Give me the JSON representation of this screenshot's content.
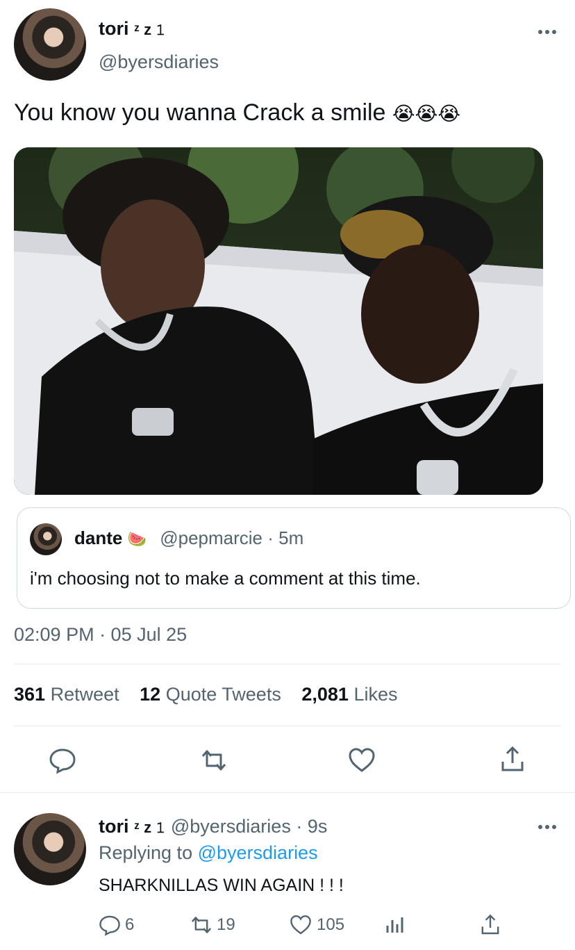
{
  "tweet": {
    "author_name": "tori",
    "author_name_decor": "ᶻ z 𝟷",
    "author_handle": "@byersdiaries",
    "text": "You know you wanna Crack a smile",
    "emoji": "😭😭😭",
    "timestamp": "02:09 PM · 05 Jul 25",
    "stats": {
      "retweets_count": "361",
      "retweets_label": "Retweet",
      "quotes_count": "12",
      "quotes_label": "Quote Tweets",
      "likes_count": "2,081",
      "likes_label": "Likes"
    }
  },
  "quoted": {
    "name": "dante",
    "emoji": "🍉",
    "meta": "@pepmarcie · 5m",
    "text": "i'm choosing not to make a comment at this time."
  },
  "reply": {
    "author_name": "tori",
    "author_name_decor": "ᶻ z 𝟷",
    "handle_time": "@byersdiaries · 9s",
    "replying_prefix": "Replying to",
    "replying_to": "@byersdiaries",
    "text": "SHARKNILLAS WIN AGAIN ! ! !",
    "counts": {
      "replies": "6",
      "retweets": "19",
      "likes": "105"
    }
  },
  "icons": {
    "more": "more-horizontal-icon",
    "reply": "speech-bubble-icon",
    "retweet": "retweet-arrows-icon",
    "like": "heart-icon",
    "share": "share-upload-icon",
    "analytics": "bar-chart-icon"
  },
  "colors": {
    "link": "#1d9bf0",
    "muted": "#536471",
    "text": "#0f1419",
    "border": "#e6ecf0"
  }
}
